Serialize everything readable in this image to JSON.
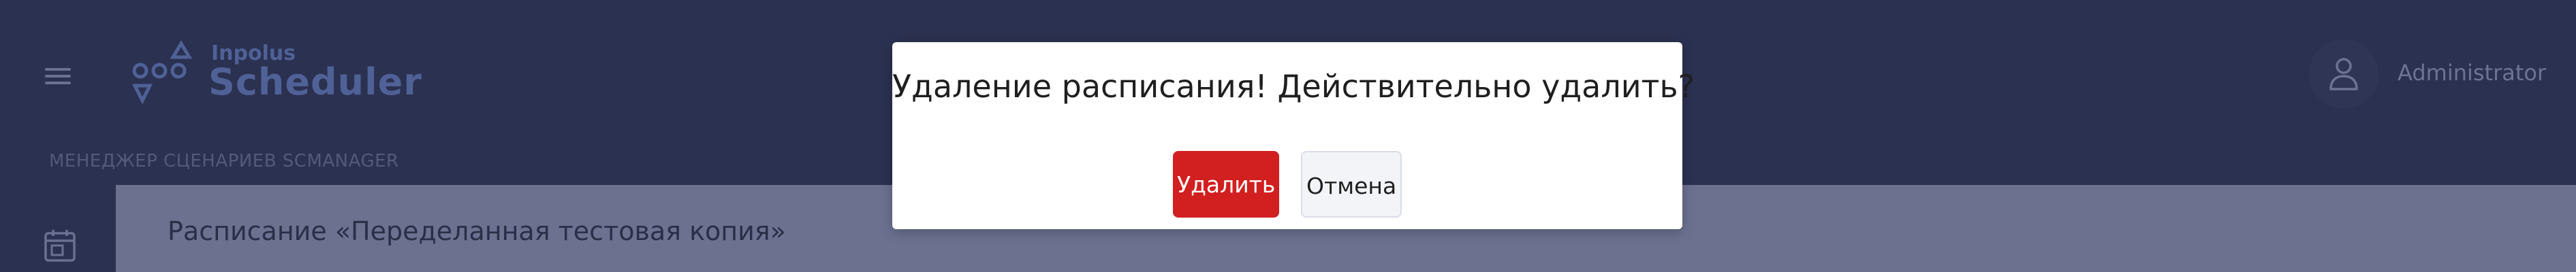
{
  "header": {
    "menu_icon": "hamburger-icon",
    "logo": {
      "icon": "inpolus-logo-icon",
      "small_text": "Inpolus",
      "big_text": "Scheduler"
    },
    "user": {
      "icon": "user-icon",
      "name": "Administrator"
    }
  },
  "section": {
    "label": "МЕНЕДЖЕР СЦЕНАРИЕВ SCMANAGER"
  },
  "sidebar": {
    "icon": "calendar-icon"
  },
  "content": {
    "title": "Расписание «Переделанная тестовая копия»"
  },
  "modal": {
    "message": "Удаление расписания! Действительно удалить?",
    "delete_label": "Удалить",
    "cancel_label": "Отмена"
  },
  "colors": {
    "header_bg": "#2b3150",
    "content_bg": "#6c7190",
    "logo": "#4f6196",
    "delete_button": "#d21f1f",
    "cancel_button": "#f3f4f8"
  }
}
